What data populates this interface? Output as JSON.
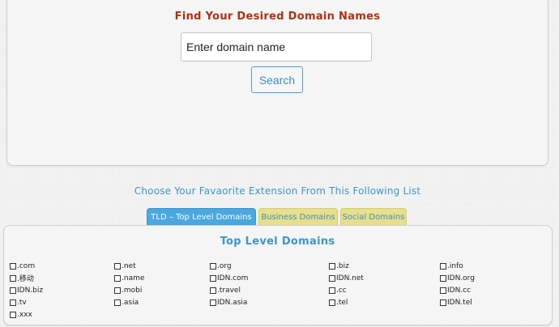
{
  "search": {
    "title": "Find Your Desired Domain Names",
    "placeholder": "Enter domain name",
    "button_label": "Search"
  },
  "extensions": {
    "intro": "Choose Your Favaorite Extension From This Following List",
    "tabs": [
      {
        "label": "TLD – Top Level Domains",
        "active": true,
        "color": "#4aa7e0"
      },
      {
        "label": "Business Domains",
        "active": false,
        "color": "#e8df8c"
      },
      {
        "label": "Social Domains",
        "active": false,
        "color": "#e8df8c"
      }
    ],
    "panel_title": "Top Level Domains",
    "columns": [
      [
        ".com",
        ".移动",
        "IDN.biz",
        ".tv",
        ".xxx"
      ],
      [
        ".net",
        ".name",
        ".mobi",
        ".asia"
      ],
      [
        ".org",
        "IDN.com",
        ".travel",
        "IDN.asia"
      ],
      [
        ".biz",
        "IDN.net",
        ".cc",
        ".tel"
      ],
      [
        ".info",
        "IDN.org",
        "IDN.cc",
        "IDN.tel"
      ]
    ]
  },
  "colors": {
    "title_red": "#b03010",
    "accent_blue": "#3b97c9",
    "tab_active": "#4aa7e0",
    "tab_inactive": "#e8df8c"
  }
}
